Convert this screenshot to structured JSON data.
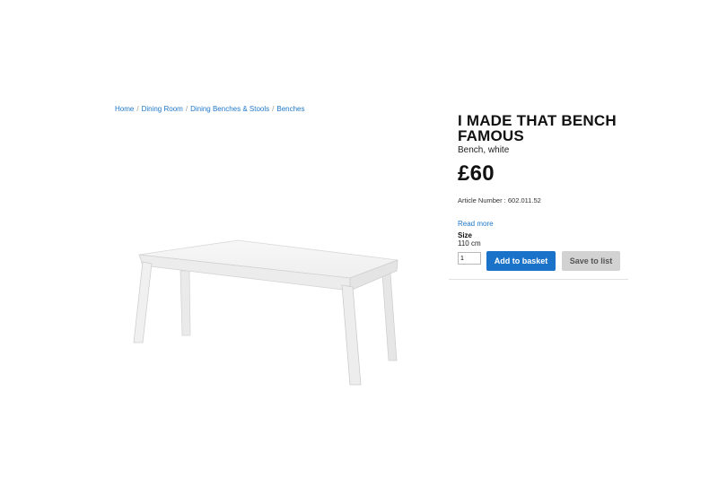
{
  "breadcrumb": {
    "items": [
      {
        "label": "Home"
      },
      {
        "label": "Dining Room"
      },
      {
        "label": "Dining Benches & Stools"
      },
      {
        "label": "Benches"
      }
    ],
    "separator": "/"
  },
  "product": {
    "title": "I MADE THAT BENCH FAMOUS",
    "subtitle": "Bench, white",
    "price": "£60",
    "article_number": "Article Number : 602.011.52",
    "read_more": "Read more",
    "size_label": "Size",
    "size_value": "110 cm",
    "image": "white-bench-image"
  },
  "actions": {
    "quantity": "1",
    "add_to_basket": "Add to basket",
    "save_to_list": "Save to list"
  },
  "colors": {
    "link": "#1e77c8",
    "primary_button": "#1a73c9",
    "secondary_button": "#d2d2d2"
  }
}
